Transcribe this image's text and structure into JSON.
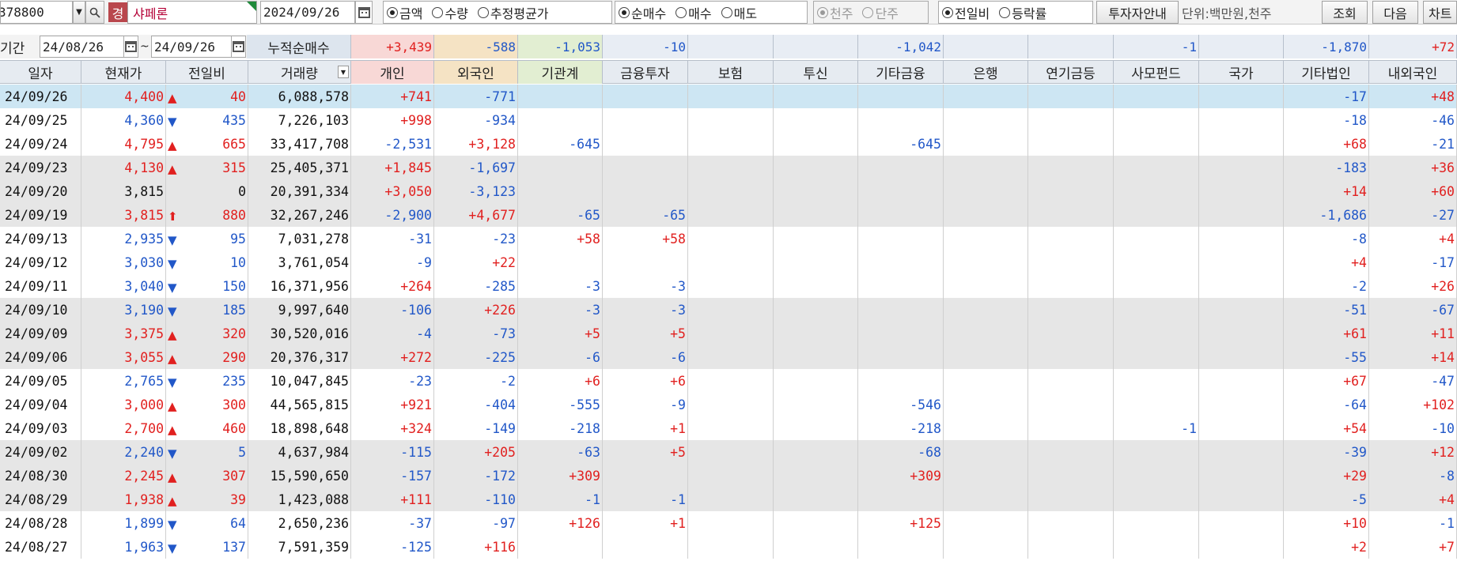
{
  "toolbar": {
    "code": "378800",
    "warn_badge": "경",
    "stock_name": "샤페론",
    "date": "2024/09/26",
    "amount_radios": [
      {
        "label": "금액",
        "selected": true
      },
      {
        "label": "수량",
        "selected": false
      },
      {
        "label": "추정평균가",
        "selected": false
      }
    ],
    "trade_radios": [
      {
        "label": "순매수",
        "selected": true
      },
      {
        "label": "매수",
        "selected": false
      },
      {
        "label": "매도",
        "selected": false
      }
    ],
    "scale_radios": [
      {
        "label": "천주",
        "selected": true
      },
      {
        "label": "단주",
        "selected": false
      }
    ],
    "compare_radios": [
      {
        "label": "전일비",
        "selected": true
      },
      {
        "label": "등락률",
        "selected": false
      }
    ],
    "investor_guide": "투자자안내",
    "unit_label": "단위:백만원,천주",
    "search": "조회",
    "next": "다음",
    "chart": "차트"
  },
  "period": {
    "label": "기간",
    "from": "24/08/26",
    "tilde": "~",
    "to": "24/09/26",
    "cum_label": "누적순매수",
    "cum_values": [
      "+3,439",
      "-588",
      "-1,053",
      "-10",
      "",
      "",
      "-1,042",
      "",
      "",
      "-1",
      "",
      "-1,870",
      "+72"
    ]
  },
  "columns": [
    "일자",
    "현재가",
    "전일비",
    "거래량",
    "개인",
    "외국인",
    "기관계",
    "금융투자",
    "보험",
    "투신",
    "기타금융",
    "은행",
    "연기금등",
    "사모펀드",
    "국가",
    "기타법인",
    "내외국인"
  ],
  "colors": {
    "up": "#e1201f",
    "down": "#2157c8",
    "flat": "#111111",
    "selected_row": "#cde6f3",
    "shade_row": "#e6e6e6"
  },
  "rows": [
    {
      "date": "24/09/26",
      "price": "4,400",
      "dir": "up",
      "change": "40",
      "volume": "6,088,578",
      "v": [
        "+741",
        "-771",
        "",
        "",
        "",
        "",
        "",
        "",
        "",
        "",
        "",
        "-17",
        "+48"
      ]
    },
    {
      "date": "24/09/25",
      "price": "4,360",
      "dir": "down",
      "change": "435",
      "volume": "7,226,103",
      "v": [
        "+998",
        "-934",
        "",
        "",
        "",
        "",
        "",
        "",
        "",
        "",
        "",
        "-18",
        "-46"
      ]
    },
    {
      "date": "24/09/24",
      "price": "4,795",
      "dir": "up",
      "change": "665",
      "volume": "33,417,708",
      "v": [
        "-2,531",
        "+3,128",
        "-645",
        "",
        "",
        "",
        "-645",
        "",
        "",
        "",
        "",
        "+68",
        "-21"
      ]
    },
    {
      "date": "24/09/23",
      "price": "4,130",
      "dir": "up",
      "change": "315",
      "volume": "25,405,371",
      "v": [
        "+1,845",
        "-1,697",
        "",
        "",
        "",
        "",
        "",
        "",
        "",
        "",
        "",
        "-183",
        "+36"
      ]
    },
    {
      "date": "24/09/20",
      "price": "3,815",
      "dir": "flat",
      "change": "0",
      "volume": "20,391,334",
      "v": [
        "+3,050",
        "-3,123",
        "",
        "",
        "",
        "",
        "",
        "",
        "",
        "",
        "",
        "+14",
        "+60"
      ]
    },
    {
      "date": "24/09/19",
      "price": "3,815",
      "dir": "limit",
      "change": "880",
      "volume": "32,267,246",
      "v": [
        "-2,900",
        "+4,677",
        "-65",
        "-65",
        "",
        "",
        "",
        "",
        "",
        "",
        "",
        "-1,686",
        "-27"
      ]
    },
    {
      "date": "24/09/13",
      "price": "2,935",
      "dir": "down",
      "change": "95",
      "volume": "7,031,278",
      "v": [
        "-31",
        "-23",
        "+58",
        "+58",
        "",
        "",
        "",
        "",
        "",
        "",
        "",
        "-8",
        "+4"
      ]
    },
    {
      "date": "24/09/12",
      "price": "3,030",
      "dir": "down",
      "change": "10",
      "volume": "3,761,054",
      "v": [
        "-9",
        "+22",
        "",
        "",
        "",
        "",
        "",
        "",
        "",
        "",
        "",
        "+4",
        "-17"
      ]
    },
    {
      "date": "24/09/11",
      "price": "3,040",
      "dir": "down",
      "change": "150",
      "volume": "16,371,956",
      "v": [
        "+264",
        "-285",
        "-3",
        "-3",
        "",
        "",
        "",
        "",
        "",
        "",
        "",
        "-2",
        "+26"
      ]
    },
    {
      "date": "24/09/10",
      "price": "3,190",
      "dir": "down",
      "change": "185",
      "volume": "9,997,640",
      "v": [
        "-106",
        "+226",
        "-3",
        "-3",
        "",
        "",
        "",
        "",
        "",
        "",
        "",
        "-51",
        "-67"
      ]
    },
    {
      "date": "24/09/09",
      "price": "3,375",
      "dir": "up",
      "change": "320",
      "volume": "30,520,016",
      "v": [
        "-4",
        "-73",
        "+5",
        "+5",
        "",
        "",
        "",
        "",
        "",
        "",
        "",
        "+61",
        "+11"
      ]
    },
    {
      "date": "24/09/06",
      "price": "3,055",
      "dir": "up",
      "change": "290",
      "volume": "20,376,317",
      "v": [
        "+272",
        "-225",
        "-6",
        "-6",
        "",
        "",
        "",
        "",
        "",
        "",
        "",
        "-55",
        "+14"
      ]
    },
    {
      "date": "24/09/05",
      "price": "2,765",
      "dir": "down",
      "change": "235",
      "volume": "10,047,845",
      "v": [
        "-23",
        "-2",
        "+6",
        "+6",
        "",
        "",
        "",
        "",
        "",
        "",
        "",
        "+67",
        "-47"
      ]
    },
    {
      "date": "24/09/04",
      "price": "3,000",
      "dir": "up",
      "change": "300",
      "volume": "44,565,815",
      "v": [
        "+921",
        "-404",
        "-555",
        "-9",
        "",
        "",
        "-546",
        "",
        "",
        "",
        "",
        "-64",
        "+102"
      ]
    },
    {
      "date": "24/09/03",
      "price": "2,700",
      "dir": "up",
      "change": "460",
      "volume": "18,898,648",
      "v": [
        "+324",
        "-149",
        "-218",
        "+1",
        "",
        "",
        "-218",
        "",
        "",
        "-1",
        "",
        "+54",
        "-10"
      ]
    },
    {
      "date": "24/09/02",
      "price": "2,240",
      "dir": "down",
      "change": "5",
      "volume": "4,637,984",
      "v": [
        "-115",
        "+205",
        "-63",
        "+5",
        "",
        "",
        "-68",
        "",
        "",
        "",
        "",
        "-39",
        "+12"
      ]
    },
    {
      "date": "24/08/30",
      "price": "2,245",
      "dir": "up",
      "change": "307",
      "volume": "15,590,650",
      "v": [
        "-157",
        "-172",
        "+309",
        "",
        "",
        "",
        "+309",
        "",
        "",
        "",
        "",
        "+29",
        "-8"
      ]
    },
    {
      "date": "24/08/29",
      "price": "1,938",
      "dir": "up",
      "change": "39",
      "volume": "1,423,088",
      "v": [
        "+111",
        "-110",
        "-1",
        "-1",
        "",
        "",
        "",
        "",
        "",
        "",
        "",
        "-5",
        "+4"
      ]
    },
    {
      "date": "24/08/28",
      "price": "1,899",
      "dir": "down",
      "change": "64",
      "volume": "2,650,236",
      "v": [
        "-37",
        "-97",
        "+126",
        "+1",
        "",
        "",
        "+125",
        "",
        "",
        "",
        "",
        "+10",
        "-1"
      ]
    },
    {
      "date": "24/08/27",
      "price": "1,963",
      "dir": "down",
      "change": "137",
      "volume": "7,591,359",
      "v": [
        "-125",
        "+116",
        "",
        "",
        "",
        "",
        "",
        "",
        "",
        "",
        "",
        "+2",
        "+7"
      ]
    }
  ]
}
